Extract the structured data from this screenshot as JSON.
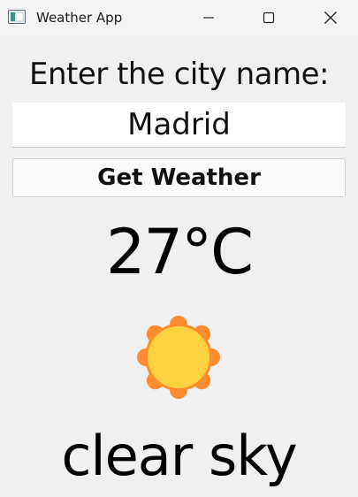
{
  "window": {
    "title": "Weather App",
    "icon": "app-window-icon"
  },
  "titlebar_controls": {
    "minimize": "minimize-icon",
    "maximize": "maximize-icon",
    "close": "close-icon"
  },
  "form": {
    "prompt_label": "Enter the city name:",
    "city_value": "Madrid",
    "button_label": "Get Weather"
  },
  "result": {
    "temperature": "27°C",
    "icon": "sun-icon",
    "description": "clear sky"
  },
  "colors": {
    "background": "#f0f0f0",
    "sun_outer": "#ff8c2e",
    "sun_inner": "#ffd23f"
  }
}
